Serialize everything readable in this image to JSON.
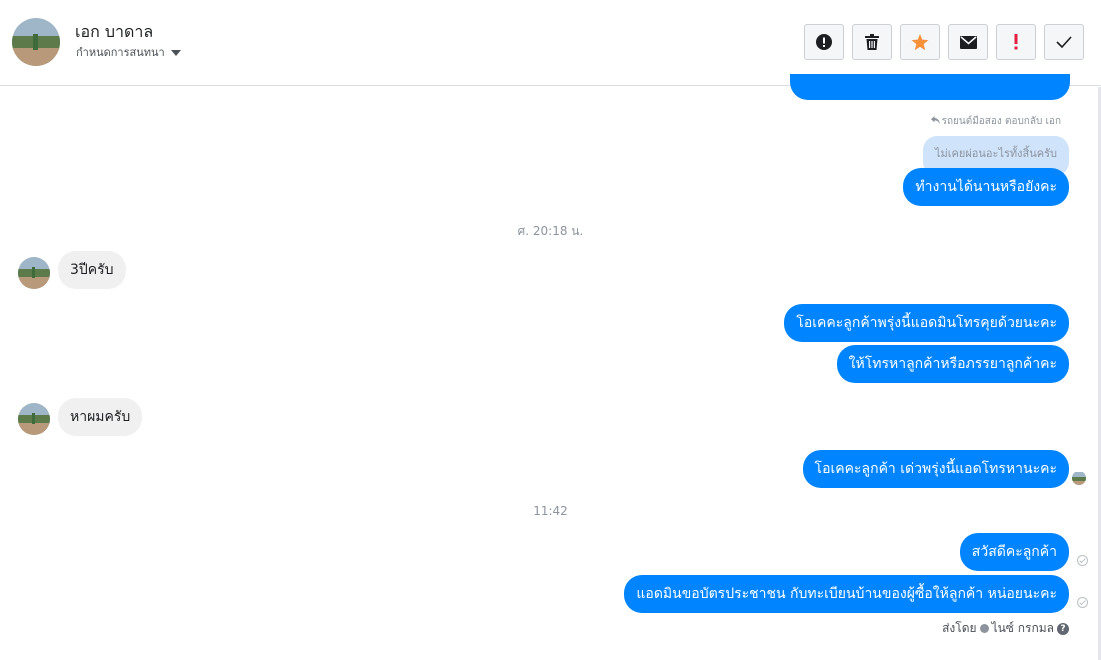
{
  "header": {
    "contact_name": "เอก บาดาล",
    "assign_label": "กำหนดการสนทนา"
  },
  "toolbar": {
    "buttons": [
      {
        "name": "alert",
        "icon": "alert-circle-icon"
      },
      {
        "name": "delete",
        "icon": "trash-icon"
      },
      {
        "name": "star",
        "icon": "star-icon",
        "color": "#f7923b"
      },
      {
        "name": "mail",
        "icon": "envelope-icon"
      },
      {
        "name": "important",
        "icon": "exclamation-icon",
        "color": "#e41e3f"
      },
      {
        "name": "done",
        "icon": "checkmark-icon"
      }
    ]
  },
  "colors": {
    "outgoing_bubble": "#0084ff",
    "incoming_bubble": "#f1f0f0",
    "quoted_bubble": "#cfe3fb"
  },
  "messages": {
    "reply_meta": "รถยนต์มือสอง ตอบกลับ เอก",
    "quoted_text": "ไม่เคยผ่อนอะไรทั้งสิ้นครับ",
    "m1": "ทำงานได้นานหรือยังคะ",
    "ts1": "ศ. 20:18 น.",
    "m2": "3ปีครับ",
    "m3": "โอเคคะลูกค้าพรุ่งนี้แอดมินโทรคุยด้วยนะคะ",
    "m4": "ให้โทรหาลูกค้าหรือภรรยาลูกค้าคะ",
    "m5": "หาผมครับ",
    "m6": "โอเคคะลูกค้า เด่วพรุ่งนี้แอดโทรหานะคะ",
    "ts2": "11:42",
    "m7": "สวัสดีคะลูกค้า",
    "m8": "แอดมินขอบัตรประชาชน กับทะเบียนบ้านของผู้ซื้อให้ลูกค้า หน่อยนะคะ"
  },
  "footer": {
    "sent_by_label": "ส่งโดย",
    "sender_name": "ไนซ์ กรกมล"
  }
}
